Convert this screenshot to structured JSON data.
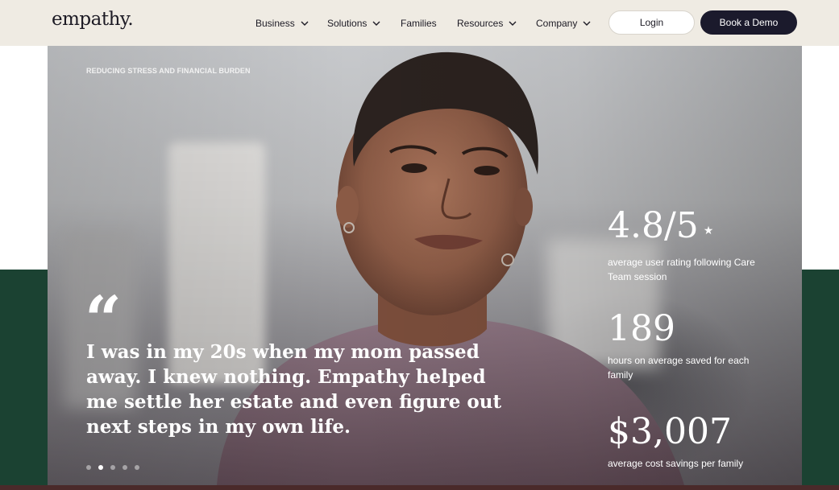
{
  "brand": {
    "logo": "empathy."
  },
  "nav": [
    {
      "label": "Business",
      "dropdown": true
    },
    {
      "label": "Solutions",
      "dropdown": true
    },
    {
      "label": "Families",
      "dropdown": false
    },
    {
      "label": "Resources",
      "dropdown": true
    },
    {
      "label": "Company",
      "dropdown": true
    }
  ],
  "header_buttons": {
    "login": "Login",
    "demo": "Book a Demo"
  },
  "hero": {
    "eyebrow": "REDUCING STRESS AND FINANCIAL BURDEN",
    "quote_mark": "“",
    "quote": "I was in my 20s when my mom passed away. I knew nothing. Empathy helped me settle her estate and even figure out next steps in my own life.",
    "carousel": {
      "count": 5,
      "active_index": 1
    }
  },
  "stats": [
    {
      "value": "4.8/5",
      "star": "★",
      "label": "average user rating following Care Team session"
    },
    {
      "value": "189",
      "label": "hours on average saved for each family"
    },
    {
      "value": "$3,007",
      "label": "average cost savings per family"
    }
  ],
  "colors": {
    "header_bg": "#efebe3",
    "dark_navy": "#1b1a2c",
    "forest_green": "#1b4232",
    "white": "#ffffff"
  }
}
